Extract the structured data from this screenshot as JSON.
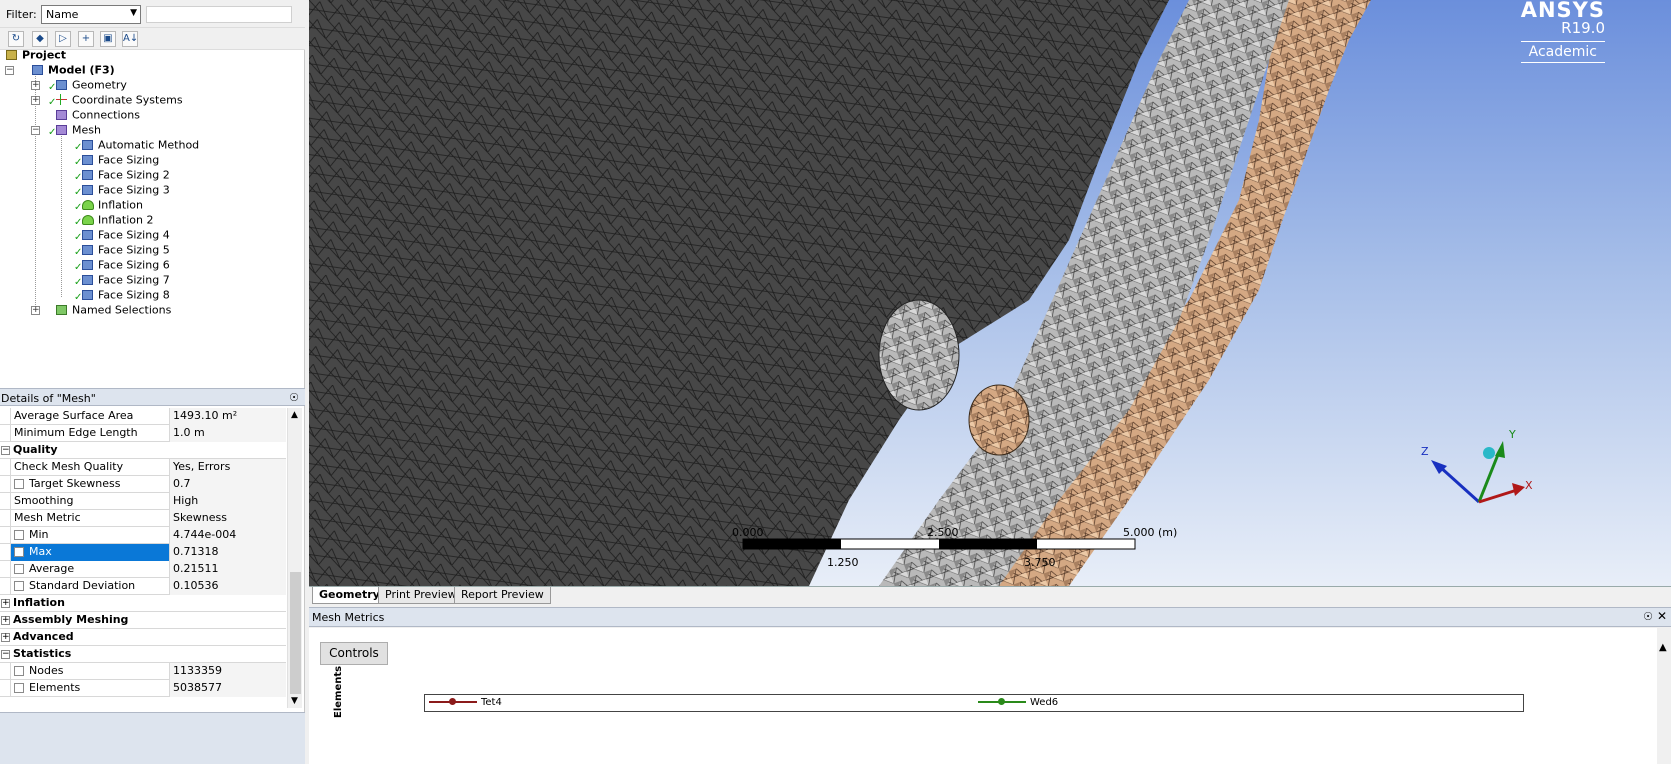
{
  "filter": {
    "label": "Filter:",
    "selected": "Name",
    "search_value": ""
  },
  "tree": {
    "project": "Project",
    "model": "Model (F3)",
    "items": [
      {
        "label": "Geometry",
        "icon": "geometry-icon"
      },
      {
        "label": "Coordinate Systems",
        "icon": "coordinate-systems-icon"
      },
      {
        "label": "Connections",
        "icon": "connections-icon"
      },
      {
        "label": "Mesh",
        "icon": "mesh-icon"
      }
    ],
    "mesh_children": [
      "Automatic Method",
      "Face Sizing",
      "Face Sizing 2",
      "Face Sizing 3",
      "Inflation",
      "Inflation 2",
      "Face Sizing 4",
      "Face Sizing 5",
      "Face Sizing 6",
      "Face Sizing 7",
      "Face Sizing 8"
    ],
    "named_selections": "Named Selections"
  },
  "details": {
    "title": "Details of \"Mesh\"",
    "pin": "☉",
    "rows": [
      {
        "name": "Average Surface Area",
        "value": "1493.10 m²"
      },
      {
        "name": "Minimum Edge Length",
        "value": "1.0 m"
      },
      {
        "group": "Quality"
      },
      {
        "name": "Check Mesh Quality",
        "value": "Yes, Errors"
      },
      {
        "name": "Target Skewness",
        "value": "0.7",
        "checkbox": true
      },
      {
        "name": "Smoothing",
        "value": "High"
      },
      {
        "name": "Mesh Metric",
        "value": "Skewness"
      },
      {
        "name": "Min",
        "value": "4.744e-004",
        "checkbox": true
      },
      {
        "name": "Max",
        "value": "0.71318",
        "checkbox": true,
        "selected": true
      },
      {
        "name": "Average",
        "value": "0.21511",
        "checkbox": true
      },
      {
        "name": "Standard Deviation",
        "value": "0.10536",
        "checkbox": true
      },
      {
        "group": "Inflation",
        "collapsed": true
      },
      {
        "group": "Assembly Meshing",
        "collapsed": true
      },
      {
        "group": "Advanced",
        "collapsed": true
      },
      {
        "group": "Statistics"
      },
      {
        "name": "Nodes",
        "value": "1133359",
        "checkbox": true
      },
      {
        "name": "Elements",
        "value": "5038577",
        "checkbox": true
      }
    ]
  },
  "brand": {
    "name": "ANSYS",
    "version": "R19.0",
    "edition": "Academic"
  },
  "scale": {
    "labels": [
      "0.000",
      "2.500",
      "5.000 (m)",
      "1.250",
      "3.750"
    ]
  },
  "triad": {
    "x": "X",
    "y": "Y",
    "z": "Z"
  },
  "tabs": [
    "Geometry",
    "Print Preview",
    "Report Preview"
  ],
  "metrics": {
    "title": "Mesh Metrics",
    "pin": "☉",
    "close": "✕",
    "controls_label": "Controls",
    "y_axis": "Elements",
    "legend": [
      {
        "name": "Tet4",
        "color": "#8b1a1a"
      },
      {
        "name": "Wed6",
        "color": "#2a8a1a"
      }
    ]
  },
  "colors": {
    "mesh_dark": "#474747",
    "mesh_grey": "#b9b9b9",
    "mesh_tan": "#d4a883",
    "selection": "#0a78d7"
  }
}
